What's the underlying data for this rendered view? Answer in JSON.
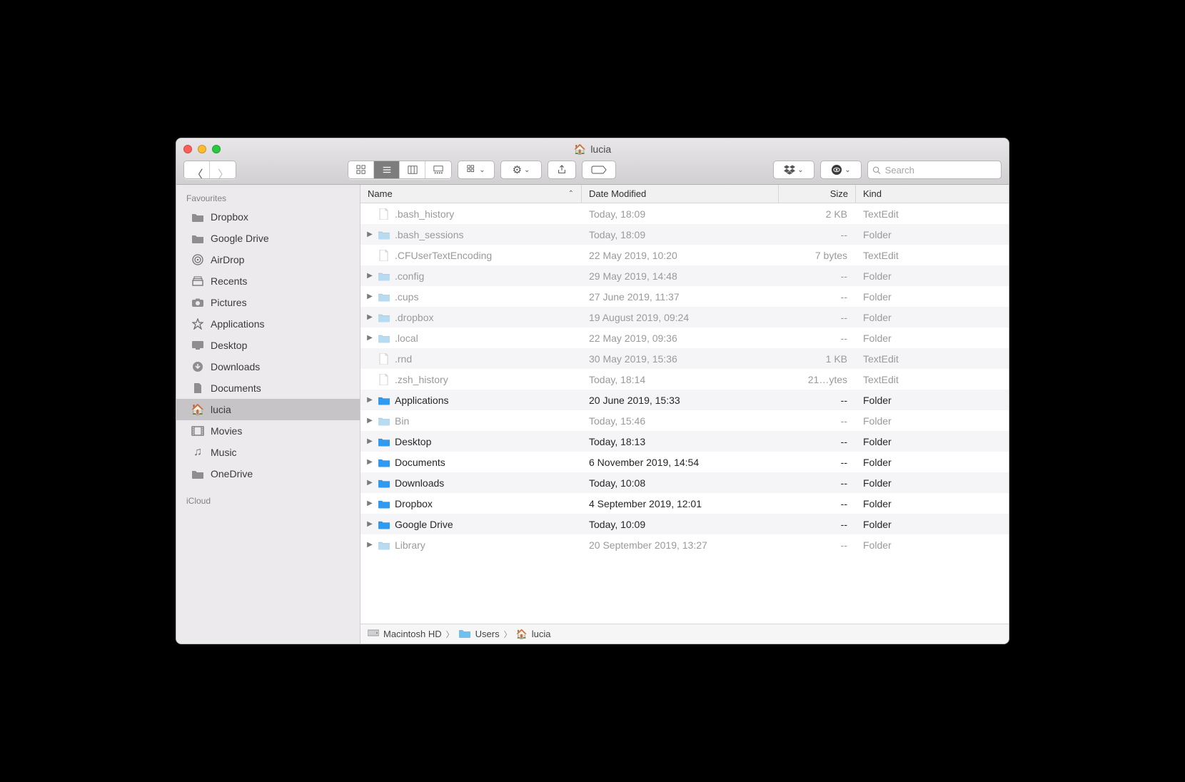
{
  "window": {
    "title": "lucia"
  },
  "search": {
    "placeholder": "Search"
  },
  "sidebar": {
    "section1": "Favourites",
    "section2": "iCloud",
    "items": [
      {
        "label": "Dropbox",
        "icon": "folder"
      },
      {
        "label": "Google Drive",
        "icon": "folder"
      },
      {
        "label": "AirDrop",
        "icon": "airdrop"
      },
      {
        "label": "Recents",
        "icon": "recents"
      },
      {
        "label": "Pictures",
        "icon": "pictures"
      },
      {
        "label": "Applications",
        "icon": "apps"
      },
      {
        "label": "Desktop",
        "icon": "desktop"
      },
      {
        "label": "Downloads",
        "icon": "downloads"
      },
      {
        "label": "Documents",
        "icon": "documents"
      },
      {
        "label": "lucia",
        "icon": "home",
        "selected": true
      },
      {
        "label": "Movies",
        "icon": "movies"
      },
      {
        "label": "Music",
        "icon": "music"
      },
      {
        "label": "OneDrive",
        "icon": "folder"
      }
    ]
  },
  "columns": {
    "name": "Name",
    "date": "Date Modified",
    "size": "Size",
    "kind": "Kind"
  },
  "rows": [
    {
      "name": ".bash_history",
      "date": "Today, 18:09",
      "size": "2 KB",
      "kind": "TextEdit",
      "type": "file",
      "hidden": true
    },
    {
      "name": ".bash_sessions",
      "date": "Today, 18:09",
      "size": "--",
      "kind": "Folder",
      "type": "folder",
      "hidden": true
    },
    {
      "name": ".CFUserTextEncoding",
      "date": "22 May 2019, 10:20",
      "size": "7 bytes",
      "kind": "TextEdit",
      "type": "file",
      "hidden": true
    },
    {
      "name": ".config",
      "date": "29 May 2019, 14:48",
      "size": "--",
      "kind": "Folder",
      "type": "folder",
      "hidden": true
    },
    {
      "name": ".cups",
      "date": "27 June 2019, 11:37",
      "size": "--",
      "kind": "Folder",
      "type": "folder",
      "hidden": true
    },
    {
      "name": ".dropbox",
      "date": "19 August 2019, 09:24",
      "size": "--",
      "kind": "Folder",
      "type": "folder",
      "hidden": true
    },
    {
      "name": ".local",
      "date": "22 May 2019, 09:36",
      "size": "--",
      "kind": "Folder",
      "type": "folder",
      "hidden": true
    },
    {
      "name": ".rnd",
      "date": "30 May 2019, 15:36",
      "size": "1 KB",
      "kind": "TextEdit",
      "type": "file",
      "hidden": true
    },
    {
      "name": ".zsh_history",
      "date": "Today, 18:14",
      "size": "21…ytes",
      "kind": "TextEdit",
      "type": "file",
      "hidden": true
    },
    {
      "name": "Applications",
      "date": "20 June 2019, 15:33",
      "size": "--",
      "kind": "Folder",
      "type": "folder",
      "hidden": false,
      "color": "#2f9af1"
    },
    {
      "name": "Bin",
      "date": "Today, 15:46",
      "size": "--",
      "kind": "Folder",
      "type": "folder",
      "hidden": true
    },
    {
      "name": "Desktop",
      "date": "Today, 18:13",
      "size": "--",
      "kind": "Folder",
      "type": "folder",
      "hidden": false,
      "color": "#2f9af1"
    },
    {
      "name": "Documents",
      "date": "6 November 2019, 14:54",
      "size": "--",
      "kind": "Folder",
      "type": "folder",
      "hidden": false,
      "color": "#2f9af1"
    },
    {
      "name": "Downloads",
      "date": "Today, 10:08",
      "size": "--",
      "kind": "Folder",
      "type": "folder",
      "hidden": false,
      "color": "#2f9af1"
    },
    {
      "name": "Dropbox",
      "date": "4 September 2019, 12:01",
      "size": "--",
      "kind": "Folder",
      "type": "folder",
      "hidden": false,
      "color": "#2f9af1"
    },
    {
      "name": "Google Drive",
      "date": "Today, 10:09",
      "size": "--",
      "kind": "Folder",
      "type": "folder",
      "hidden": false,
      "color": "#2f9af1"
    },
    {
      "name": "Library",
      "date": "20 September 2019, 13:27",
      "size": "--",
      "kind": "Folder",
      "type": "folder",
      "hidden": true
    }
  ],
  "path": {
    "parts": [
      {
        "label": "Macintosh HD",
        "icon": "disk"
      },
      {
        "label": "Users",
        "icon": "folder"
      },
      {
        "label": "lucia",
        "icon": "home"
      }
    ]
  }
}
